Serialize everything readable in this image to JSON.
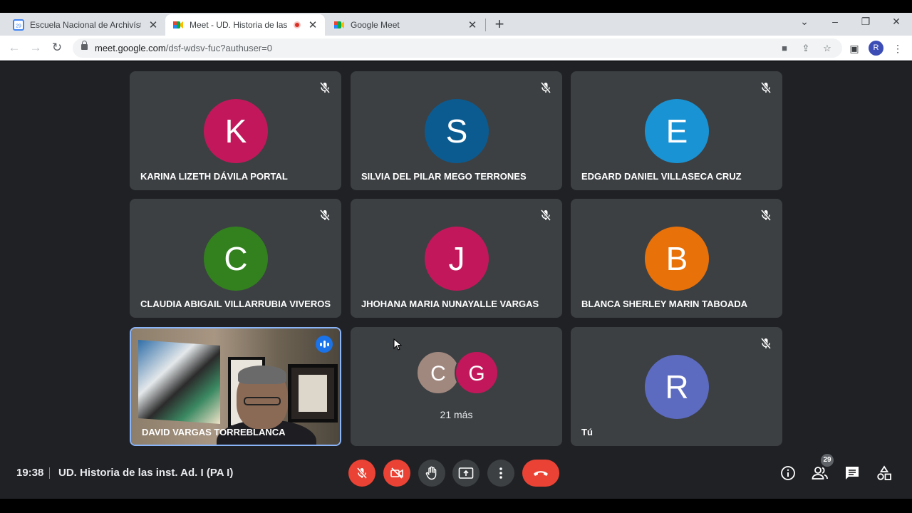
{
  "browser": {
    "tabs": [
      {
        "title": "Escuela Nacional de Archivística",
        "active": false
      },
      {
        "title": "Meet - UD. Historia de las inst.",
        "active": true,
        "recording": true
      },
      {
        "title": "Google Meet",
        "active": false
      }
    ],
    "url_host": "meet.google.com",
    "url_path": "/dsf-wdsv-fuc?authuser=0",
    "profile_initial": "R",
    "calendar_day": "29"
  },
  "participants": [
    {
      "initial": "K",
      "name": "KARINA LIZETH DÁVILA PORTAL",
      "color": "#c2185b",
      "muted": true
    },
    {
      "initial": "S",
      "name": "SILVIA DEL PILAR MEGO TERRONES",
      "color": "#0b5b91",
      "muted": true
    },
    {
      "initial": "E",
      "name": "EDGARD DANIEL VILLASECA CRUZ",
      "color": "#1a93d4",
      "muted": true
    },
    {
      "initial": "C",
      "name": "CLAUDIA ABIGAIL VILLARRUBIA VIVEROS",
      "color": "#33801f",
      "muted": true
    },
    {
      "initial": "J",
      "name": "JHOHANA MARIA NUNAYALLE VARGAS",
      "color": "#c2185b",
      "muted": true
    },
    {
      "initial": "B",
      "name": "BLANCA SHERLEY MARIN TABOADA",
      "color": "#e8710a",
      "muted": true
    }
  ],
  "speaker": {
    "name": "DAVID VARGAS TORREBLANCA",
    "speaking": true
  },
  "more_tile": {
    "avatars": [
      {
        "initial": "C",
        "color": "#a1887f"
      },
      {
        "initial": "G",
        "color": "#c2185b"
      }
    ],
    "label": "21 más"
  },
  "self_tile": {
    "initial": "R",
    "name": "Tú",
    "color": "#5c6bc0",
    "muted": true
  },
  "bottom_bar": {
    "time": "19:38",
    "meeting_title": "UD. Historia de las inst. Ad. I (PA I)",
    "participant_count": "29",
    "accent_red": "#ea4335"
  }
}
